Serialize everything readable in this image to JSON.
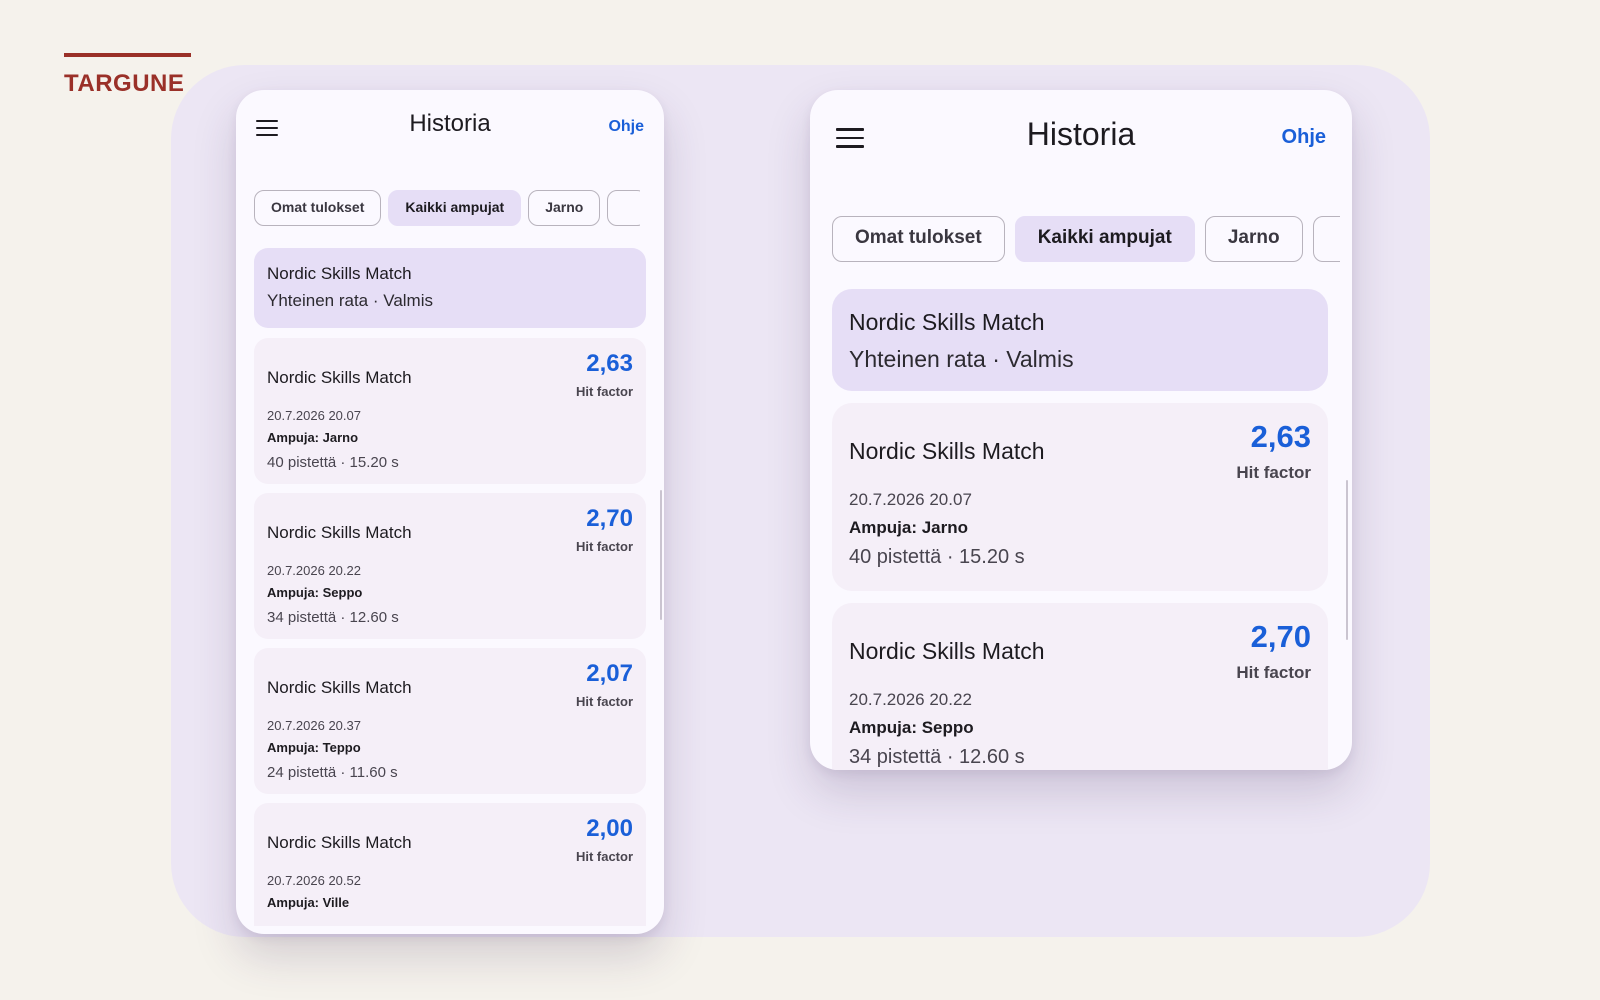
{
  "brand": "TARGUNE",
  "colors": {
    "accent": "#1a5fd8",
    "brand": "#9a3028",
    "chip_active": "#e6def6",
    "card_bg": "#f5eff8"
  },
  "screen": {
    "title": "Historia",
    "help_label": "Ohje",
    "menu_icon": "menu-icon",
    "chips": [
      {
        "label": "Omat tulokset",
        "active": false
      },
      {
        "label": "Kaikki ampujat",
        "active": true
      },
      {
        "label": "Jarno",
        "active": false
      },
      {
        "label": "",
        "active": false
      }
    ],
    "hero": {
      "title": "Nordic Skills Match",
      "subtitle": "Yhteinen rata · Valmis"
    },
    "results": [
      {
        "name": "Nordic Skills Match",
        "score": "2,63",
        "score_label": "Hit factor",
        "date": "20.7.2026 20.07",
        "shooter": "Ampuja: Jarno",
        "stats": "40 pistettä · 15.20 s"
      },
      {
        "name": "Nordic Skills Match",
        "score": "2,70",
        "score_label": "Hit factor",
        "date": "20.7.2026 20.22",
        "shooter": "Ampuja: Seppo",
        "stats": "34 pistettä · 12.60 s"
      },
      {
        "name": "Nordic Skills Match",
        "score": "2,07",
        "score_label": "Hit factor",
        "date": "20.7.2026 20.37",
        "shooter": "Ampuja: Teppo",
        "stats": "24 pistettä · 11.60 s"
      },
      {
        "name": "Nordic Skills Match",
        "score": "2,00",
        "score_label": "Hit factor",
        "date": "20.7.2026 20.52",
        "shooter": "Ampuja: Ville",
        "stats": ""
      }
    ]
  }
}
